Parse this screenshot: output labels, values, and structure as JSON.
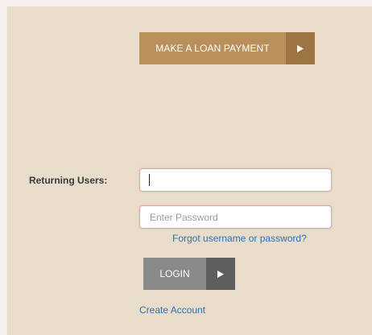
{
  "loan_payment": {
    "label": "MAKE A LOAN PAYMENT",
    "arrow_icon": "play-triangle-icon"
  },
  "login_form": {
    "returning_label": "Returning Users:",
    "username_value": "",
    "password_placeholder": "Enter Password",
    "forgot_link": "Forgot username or password?",
    "login_label": "LOGIN",
    "login_arrow_icon": "play-triangle-icon",
    "create_account_link": "Create Account"
  },
  "colors": {
    "panel_bg": "#e8dccb",
    "loan_button": "#b99059",
    "loan_arrow": "#9c7542",
    "login_button": "#8a8a8a",
    "login_arrow": "#5e5e5e",
    "link": "#2a72b8",
    "field_border": "#e8a0a4"
  }
}
